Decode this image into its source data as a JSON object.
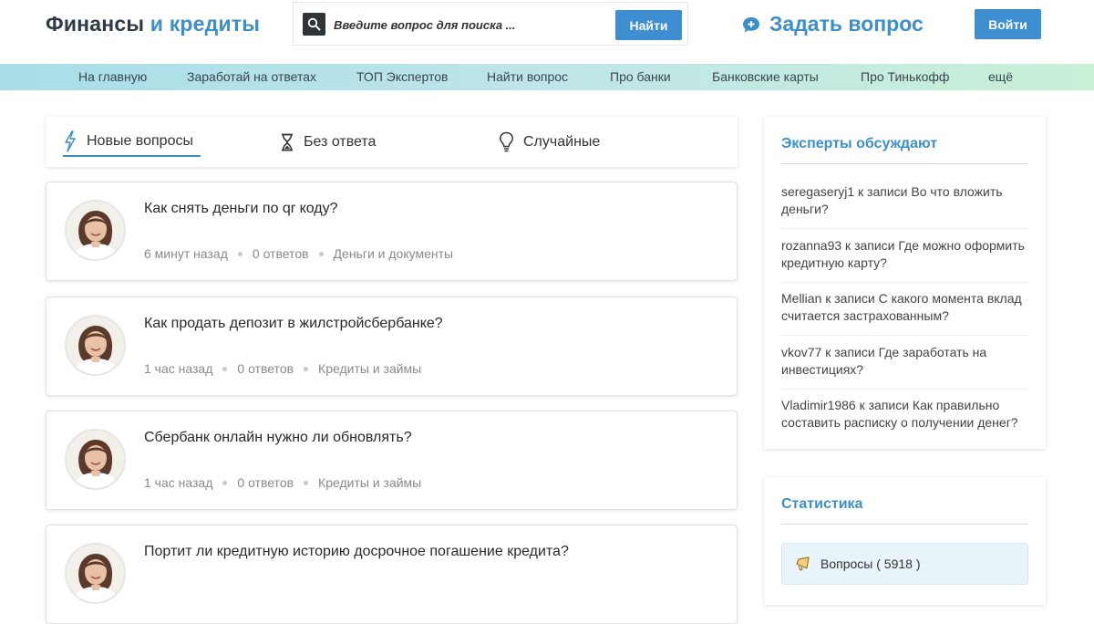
{
  "header": {
    "logo_part1": "Финансы",
    "logo_part2": "и кредиты",
    "search_placeholder": "Введите вопрос для поиска ...",
    "search_button": "Найти",
    "ask_label": "Задать вопрос",
    "login_button": "Войти"
  },
  "nav": {
    "items": [
      "На главную",
      "Заработай на ответах",
      "ТОП Экспертов",
      "Найти вопрос",
      "Про банки",
      "Банковские карты",
      "Про Тинькофф",
      "ещё"
    ]
  },
  "tabs": [
    {
      "label": "Новые вопросы",
      "icon": "lightning-icon",
      "active": true
    },
    {
      "label": "Без ответа",
      "icon": "hourglass-icon",
      "active": false
    },
    {
      "label": "Случайные",
      "icon": "lightbulb-icon",
      "active": false
    }
  ],
  "questions": [
    {
      "title": "Как снять деньги по qr коду?",
      "time": "6 минут назад",
      "answers": "0 ответов",
      "category": "Деньги и документы"
    },
    {
      "title": "Как продать депозит в жилстройсбербанке?",
      "time": "1 час назад",
      "answers": "0 ответов",
      "category": "Кредиты и займы"
    },
    {
      "title": "Сбербанк онлайн нужно ли обновлять?",
      "time": "1 час назад",
      "answers": "0 ответов",
      "category": "Кредиты и займы"
    },
    {
      "title": "Портит ли кредитную историю досрочное погашение кредита?",
      "time": "",
      "answers": "",
      "category": ""
    }
  ],
  "experts": {
    "title": "Эксперты обсуждают",
    "items": [
      "seregaseryj1 к записи Во что вложить деньги?",
      "rozanna93 к записи Где можно оформить кредитную карту?",
      "Mellian к записи С какого момента вклад считается застрахованным?",
      "vkov77 к записи Где заработать на инвестициях?",
      "Vladimir1986 к записи Как правильно составить расписку о получении денег?"
    ]
  },
  "stats": {
    "title": "Статистика",
    "questions_label": "Вопросы ( 5918 )"
  },
  "colors": {
    "accent": "#3d8fc9",
    "button": "#3d8fd1",
    "logo_dark": "#2e3a47"
  }
}
